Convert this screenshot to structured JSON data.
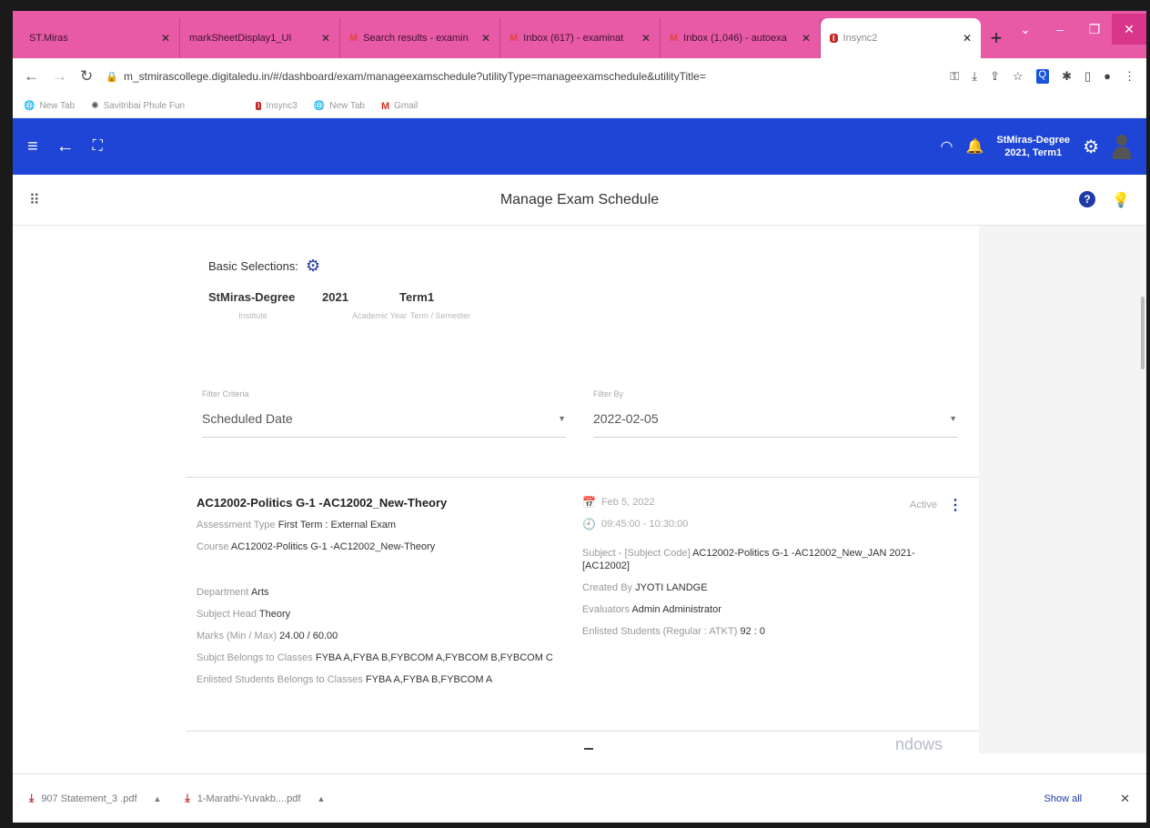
{
  "browser": {
    "tabs": [
      {
        "title": "ST.Miras",
        "icon": ""
      },
      {
        "title": "markSheetDisplay1_UI",
        "icon": ""
      },
      {
        "title": "Search results - examin",
        "icon": "M"
      },
      {
        "title": "Inbox (617) - examinat",
        "icon": "M"
      },
      {
        "title": "Inbox (1,046) - autoexa",
        "icon": "M"
      },
      {
        "title": "Insync2",
        "icon": "I"
      }
    ],
    "url": "m_stmirascollege.digitaledu.in/#/dashboard/exam/manageexamschedule?utilityType=manageexamschedule&utilityTitle=",
    "bookmarks": [
      "New Tab",
      "Savitribai Phule Fun",
      "Insync3",
      "New Tab",
      "Gmail"
    ]
  },
  "header": {
    "institute": "StMiras-Degree",
    "session": "2021, Term1"
  },
  "page": {
    "title": "Manage Exam Schedule"
  },
  "basic": {
    "label": "Basic Selections:",
    "institute": "StMiras-Degree",
    "year": "2021",
    "term": "Term1",
    "institute_lbl": "Institute",
    "year_lbl": "Academic Year",
    "term_lbl": "Term / Semester"
  },
  "filters": {
    "criteria_label": "Filter Criteria",
    "criteria_value": "Scheduled Date",
    "by_label": "Filter By",
    "by_value": "2022-02-05"
  },
  "card": {
    "title": "AC12002-Politics G-1 -AC12002_New-Theory",
    "assessment_label": "Assessment Type",
    "assessment_value": "First Term : External Exam",
    "course_label": "Course",
    "course_value": "AC12002-Politics G-1 -AC12002_New-Theory",
    "department_label": "Department",
    "department_value": "Arts",
    "subject_head_label": "Subject Head",
    "subject_head_value": "Theory",
    "marks_label": "Marks (Min / Max)",
    "marks_value": "24.00 / 60.00",
    "belongs_label": "Subjct Belongs to Classes",
    "belongs_value": "FYBA A,FYBA B,FYBCOM A,FYBCOM B,FYBCOM C",
    "enlisted_classes_label": "Enlisted Students Belongs to Classes",
    "enlisted_classes_value": "FYBA A,FYBA B,FYBCOM A",
    "date": "Feb 5, 2022",
    "time": "09:45:00 - 10:30:00",
    "status": "Active",
    "subject_label": "Subject - [Subject Code]",
    "subject_value": "AC12002-Politics G-1 -AC12002_New_JAN 2021-",
    "subject_code": "[AC12002]",
    "created_label": "Created By",
    "created_value": "JYOTI LANDGE",
    "evaluators_label": "Evaluators",
    "evaluators_value": "Admin Administrator",
    "enlisted_label": "Enlisted Students (Regular : ATKT)",
    "enlisted_value": "92 : 0"
  },
  "watermark": "ndows",
  "downloads": {
    "files": [
      "907 Statement_3 .pdf",
      "1-Marathi-Yuvakb....pdf"
    ],
    "show_all": "Show all"
  }
}
